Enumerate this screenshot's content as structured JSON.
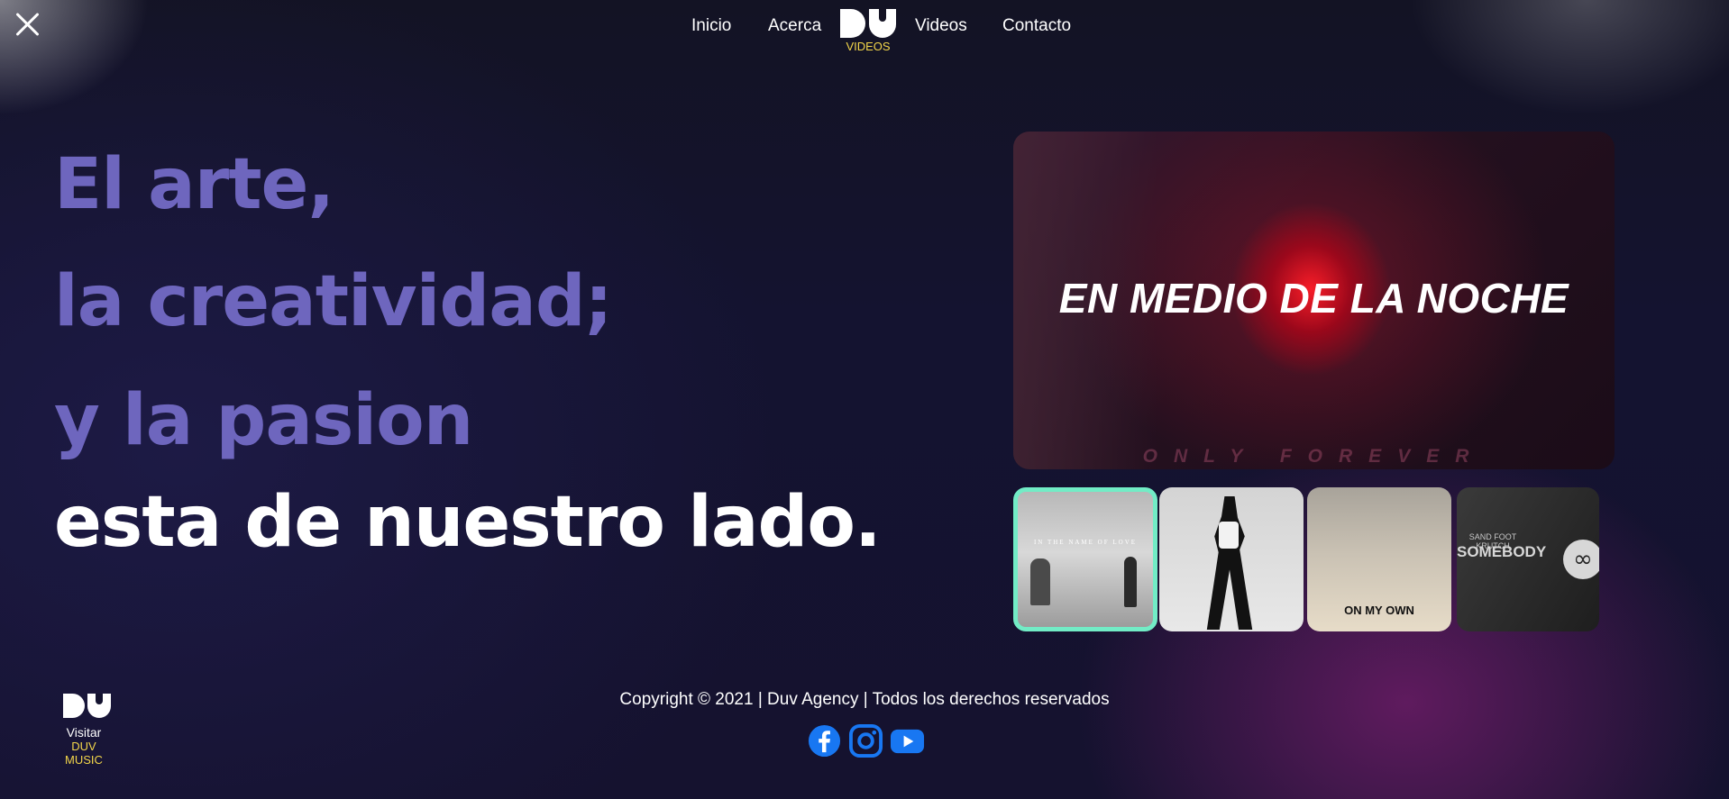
{
  "nav": {
    "items": [
      "Inicio",
      "Acerca",
      "Videos",
      "Contacto"
    ],
    "logo_sub": "VIDEOS"
  },
  "hero": {
    "line1": "El arte,",
    "line2": "la creatividad;",
    "line3": "y la pasion",
    "line4": "esta de nuestro lado."
  },
  "feature": {
    "title": "EN MEDIO DE LA NOCHE",
    "subtitle": "ONLY FOREVER"
  },
  "thumbnails": [
    {
      "label": "IN THE NAME OF LOVE",
      "active": true
    },
    {
      "label": "",
      "active": false
    },
    {
      "label": "ON MY OWN",
      "active": false
    },
    {
      "label_top": "SAND FOOT KRUTCH",
      "label": "SOMEBODY",
      "active": false
    }
  ],
  "footer": {
    "visit": "Visitar",
    "brand": "DUV MUSIC",
    "copyright": "Copyright © 2021 | Duv Agency | Todos los derechos reservados",
    "social": [
      "facebook-icon",
      "instagram-icon",
      "youtube-icon"
    ]
  },
  "colors": {
    "accent_purple": "#6e66be",
    "accent_yellow": "#f3d64a",
    "active_border": "#72ecc6",
    "social_blue": "#1877f2"
  }
}
